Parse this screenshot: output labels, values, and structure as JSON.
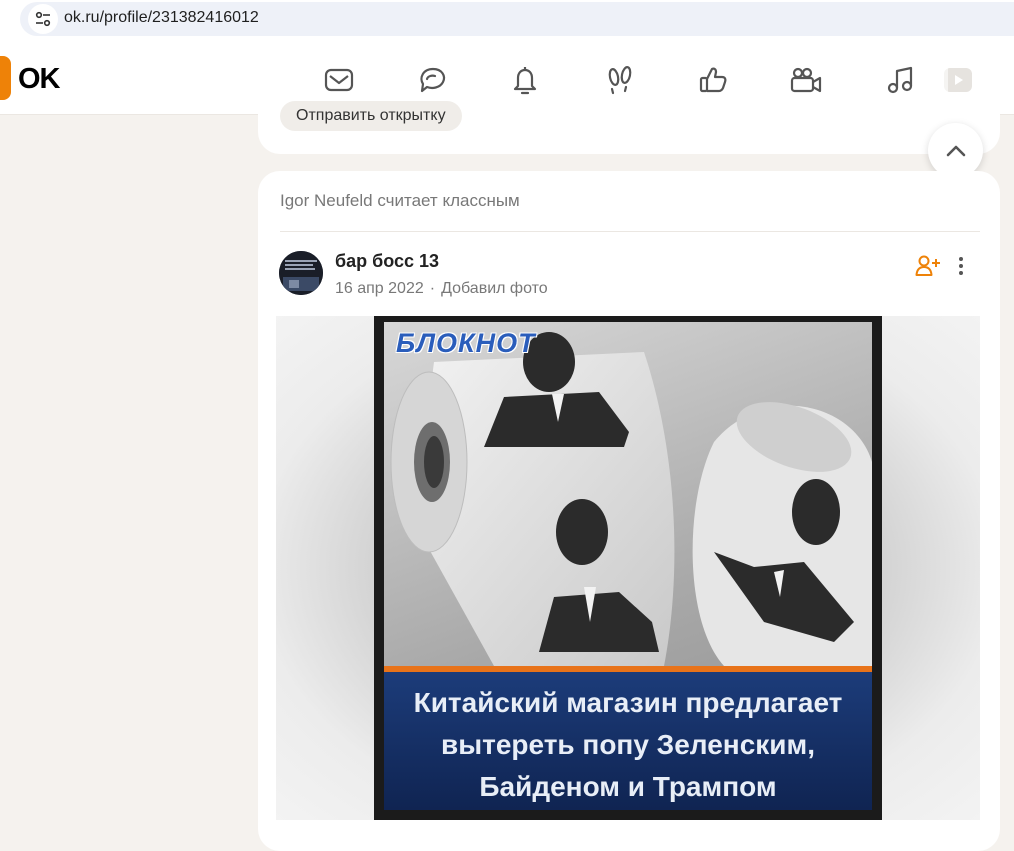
{
  "browser": {
    "url": "ok.ru/profile/231382416012",
    "site_info_icon": "tune-icon"
  },
  "header": {
    "logo": "OK",
    "nav": [
      {
        "icon": "mail-icon"
      },
      {
        "icon": "chat-icon"
      },
      {
        "icon": "bell-icon"
      },
      {
        "icon": "footprints-icon"
      },
      {
        "icon": "thumbs-up-icon"
      },
      {
        "icon": "video-camera-icon"
      },
      {
        "icon": "music-icon"
      },
      {
        "icon": "video-play-icon"
      }
    ]
  },
  "top_card": {
    "send_postcard_label": "Отправить открытку"
  },
  "post": {
    "activity": "Igor Neufeld считает классным",
    "author": "бар босс 13",
    "date": "16 апр 2022",
    "separator": "·",
    "action": "Добавил фото",
    "image": {
      "brand": "БЛОКНОТ",
      "caption_lines": [
        "Китайский магазин предлагает",
        "вытереть попу Зеленским,",
        "Байденом и Трампом"
      ]
    }
  },
  "colors": {
    "accent": "#ee8208",
    "background": "#f5f2ee",
    "card": "#ffffff",
    "muted_text": "#787878"
  }
}
